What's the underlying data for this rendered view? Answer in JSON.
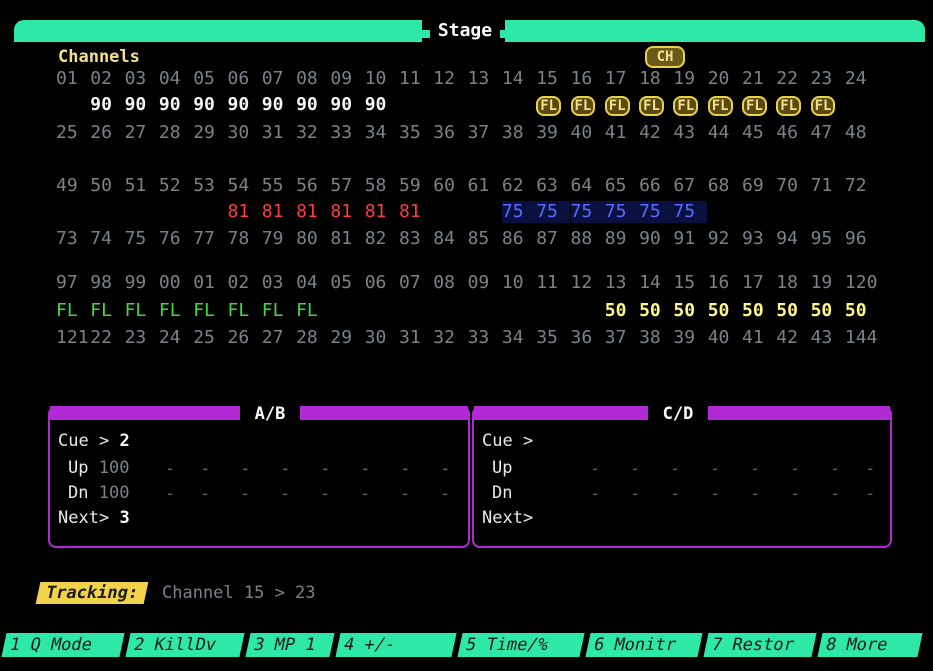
{
  "stage": {
    "title": "Stage"
  },
  "channels": {
    "label": "Channels",
    "ch_badge": "CH",
    "rows": [
      {
        "numbers": [
          "01",
          "02",
          "03",
          "04",
          "05",
          "06",
          "07",
          "08",
          "09",
          "10",
          "11",
          "12",
          "13",
          "14",
          "15",
          "16",
          "17",
          "18",
          "19",
          "20",
          "21",
          "22",
          "23",
          "24"
        ],
        "values": [
          "",
          "90",
          "90",
          "90",
          "90",
          "90",
          "90",
          "90",
          "90",
          "90",
          "",
          "",
          "",
          "",
          "FL",
          "FL",
          "FL",
          "FL",
          "FL",
          "FL",
          "FL",
          "FL",
          "FL",
          ""
        ],
        "styles": [
          "",
          "white",
          "white",
          "white",
          "white",
          "white",
          "white",
          "white",
          "white",
          "white",
          "",
          "",
          "",
          "",
          "fl",
          "fl",
          "fl",
          "fl",
          "fl",
          "fl",
          "fl",
          "fl",
          "fl",
          ""
        ]
      },
      {
        "numbers": [
          "25",
          "26",
          "27",
          "28",
          "29",
          "30",
          "31",
          "32",
          "33",
          "34",
          "35",
          "36",
          "37",
          "38",
          "39",
          "40",
          "41",
          "42",
          "43",
          "44",
          "45",
          "46",
          "47",
          "48"
        ],
        "values": [],
        "styles": []
      },
      {
        "numbers": [
          "49",
          "50",
          "51",
          "52",
          "53",
          "54",
          "55",
          "56",
          "57",
          "58",
          "59",
          "60",
          "61",
          "62",
          "63",
          "64",
          "65",
          "66",
          "67",
          "68",
          "69",
          "70",
          "71",
          "72"
        ],
        "values": [
          "",
          "",
          "",
          "",
          "",
          "81",
          "81",
          "81",
          "81",
          "81",
          "81",
          "",
          "",
          "75",
          "75",
          "75",
          "75",
          "75",
          "75",
          "",
          "",
          "",
          "",
          ""
        ],
        "styles": [
          "",
          "",
          "",
          "",
          "",
          "red",
          "red",
          "red",
          "red",
          "red",
          "red",
          "",
          "",
          "blue",
          "blue",
          "blue",
          "blue",
          "blue",
          "blue",
          "",
          "",
          "",
          "",
          ""
        ]
      },
      {
        "numbers": [
          "73",
          "74",
          "75",
          "76",
          "77",
          "78",
          "79",
          "80",
          "81",
          "82",
          "83",
          "84",
          "85",
          "86",
          "87",
          "88",
          "89",
          "90",
          "91",
          "92",
          "93",
          "94",
          "95",
          "96"
        ],
        "values": [],
        "styles": []
      },
      {
        "numbers": [
          "97",
          "98",
          "99",
          "00",
          "01",
          "02",
          "03",
          "04",
          "05",
          "06",
          "07",
          "08",
          "09",
          "10",
          "11",
          "12",
          "13",
          "14",
          "15",
          "16",
          "17",
          "18",
          "19",
          "120"
        ],
        "values": [
          "FL",
          "FL",
          "FL",
          "FL",
          "FL",
          "FL",
          "FL",
          "FL",
          "",
          "",
          "",
          "",
          "",
          "",
          "",
          "",
          "50",
          "50",
          "50",
          "50",
          "50",
          "50",
          "50",
          "50"
        ],
        "styles": [
          "green",
          "green",
          "green",
          "green",
          "green",
          "green",
          "green",
          "green",
          "",
          "",
          "",
          "",
          "",
          "",
          "",
          "",
          "yellow",
          "yellow",
          "yellow",
          "yellow",
          "yellow",
          "yellow",
          "yellow",
          "yellow"
        ]
      },
      {
        "numbers": [
          "121",
          "22",
          "23",
          "24",
          "25",
          "26",
          "27",
          "28",
          "29",
          "30",
          "31",
          "32",
          "33",
          "34",
          "35",
          "36",
          "37",
          "38",
          "39",
          "40",
          "41",
          "42",
          "43",
          "144"
        ],
        "values": [],
        "styles": []
      }
    ]
  },
  "panels": {
    "ab": {
      "title": "A/B",
      "cue_label": "Cue >",
      "cue_value": "2",
      "up_label": "Up",
      "up_value": "100",
      "dn_label": "Dn",
      "dn_value": "100",
      "next_label": "Next>",
      "next_value": "3"
    },
    "cd": {
      "title": "C/D",
      "cue_label": "Cue >",
      "cue_value": "",
      "up_label": "Up",
      "up_value": "",
      "dn_label": "Dn",
      "dn_value": "",
      "next_label": "Next>",
      "next_value": ""
    }
  },
  "tracking": {
    "label": "Tracking:",
    "text": "Channel 15 > 23"
  },
  "softkeys": [
    "1 Q Mode",
    "2 KillDv",
    "3 MP 1",
    "4 +/-",
    "5 Time/%",
    "6 Monitr",
    "7 Restor",
    "8 More"
  ],
  "colors": {
    "accent": "#2ee8a8",
    "panel": "#b12ad6",
    "highlight": "#f2d24a"
  }
}
